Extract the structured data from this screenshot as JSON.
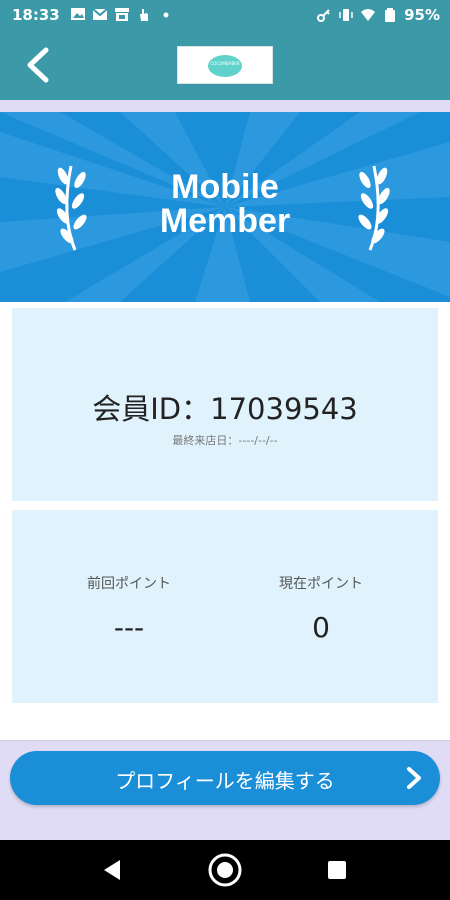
{
  "status_bar": {
    "time": "18:33",
    "battery": "95%",
    "left_icons": [
      "image-icon",
      "gmail-icon",
      "store-icon",
      "hand-icon",
      "dot-icon"
    ],
    "right_icons": [
      "key-icon",
      "vibrate-icon",
      "wifi-icon",
      "battery-icon"
    ]
  },
  "header": {
    "back_icon": "chevron-left-icon",
    "logo_text": "COCOMEMBER"
  },
  "banner": {
    "title_line1": "Mobile",
    "title_line2": "Member",
    "left_icon": "laurel-icon",
    "right_icon": "laurel-icon"
  },
  "member": {
    "id_label": "会員ID：",
    "id_value": "17039543",
    "last_visit_label": "最終来店日：",
    "last_visit_value": "----/--/--"
  },
  "points": {
    "previous_label": "前回ポイント",
    "previous_value": "---",
    "current_label": "現在ポイント",
    "current_value": "0"
  },
  "actions": {
    "edit_profile_label": "プロフィールを編集する",
    "edit_profile_icon": "chevron-right-icon"
  },
  "navigation": {
    "back": "triangle-back-icon",
    "home": "circle-home-icon",
    "recents": "square-recents-icon"
  },
  "colors": {
    "header": "#3c9aa8",
    "banner": "#1b8ed8",
    "panel": "#e0f3fd",
    "lavender": "#e0dcf6",
    "button": "#1b8ed8"
  }
}
